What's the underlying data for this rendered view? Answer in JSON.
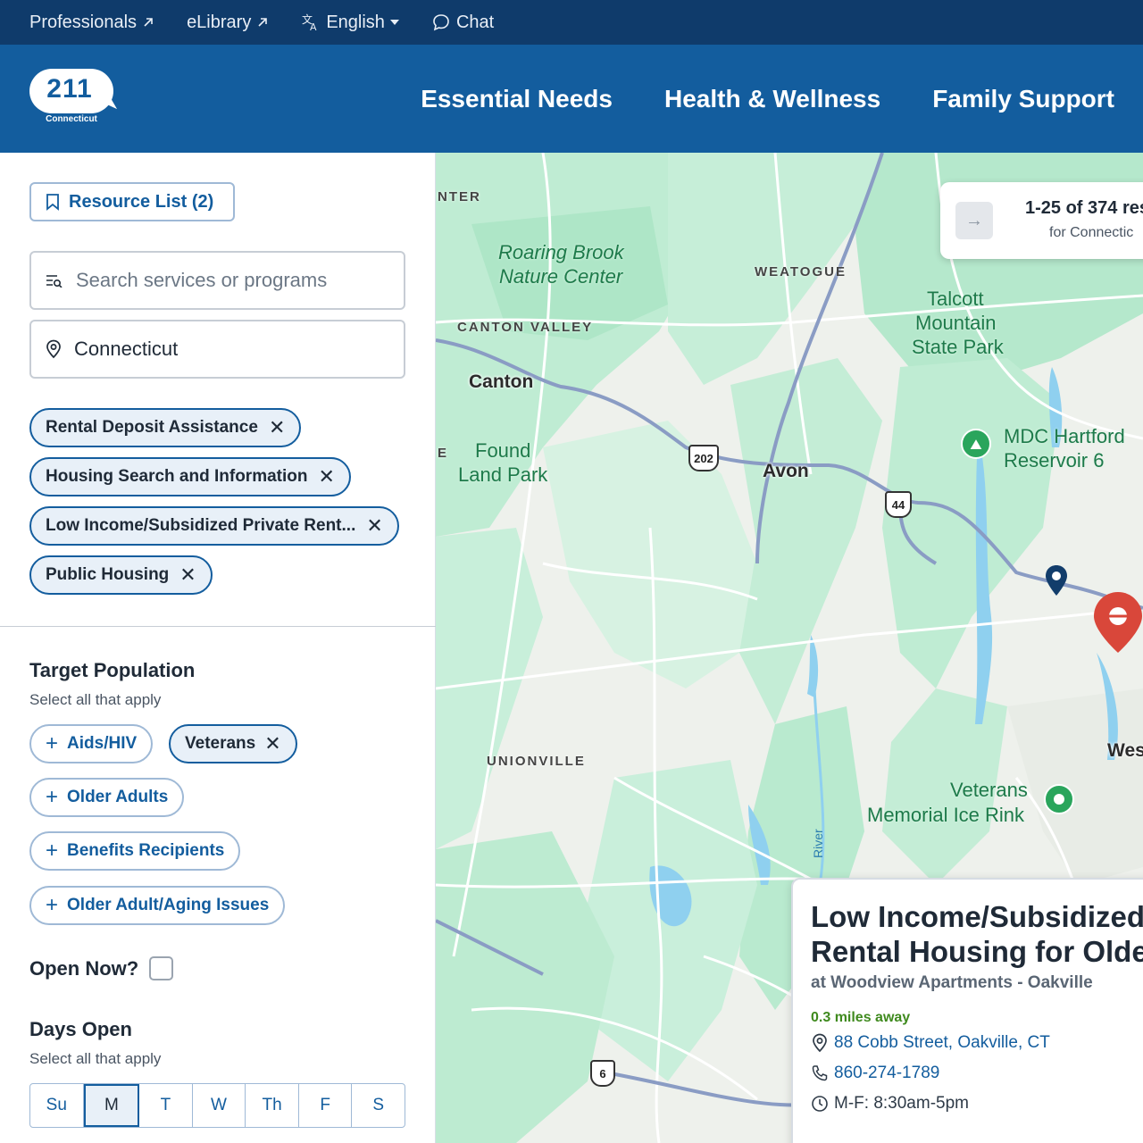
{
  "utilbar": {
    "professionals": "Professionals",
    "elibrary": "eLibrary",
    "language": "English",
    "chat": "Chat"
  },
  "header": {
    "logo_number": "211",
    "logo_subtitle": "Connecticut",
    "nav": [
      "Essential Needs",
      "Health & Wellness",
      "Family Support"
    ]
  },
  "sidebar": {
    "resource_list_label": "Resource List (2)",
    "search_placeholder": "Search services or programs",
    "location_value": "Connecticut",
    "selected_filters": [
      "Rental Deposit Assistance",
      "Housing Search and Information",
      "Low Income/Subsidized Private Rent...",
      "Public Housing"
    ],
    "target_population": {
      "title": "Target Population",
      "subtitle": "Select all that apply",
      "options": [
        {
          "label": "Aids/HIV",
          "selected": false
        },
        {
          "label": "Veterans",
          "selected": true
        },
        {
          "label": "Older Adults",
          "selected": false
        },
        {
          "label": "Benefits Recipients",
          "selected": false
        },
        {
          "label": "Older Adult/Aging Issues",
          "selected": false
        }
      ]
    },
    "open_now_label": "Open Now?",
    "days_open": {
      "title": "Days Open",
      "subtitle": "Select all that apply",
      "days": [
        "Su",
        "M",
        "T",
        "W",
        "Th",
        "F",
        "S"
      ],
      "selected": "M"
    }
  },
  "map": {
    "labels": {
      "nter": "NTER",
      "roaring": "Roaring Brook",
      "nature": "Nature Center",
      "weatogue": "WEATOGUE",
      "talcott1": "Talcott",
      "talcott2": "Mountain",
      "talcott3": "State Park",
      "canton_valley": "CANTON VALLEY",
      "canton": "Canton",
      "found1": "Found",
      "found2": "Land Park",
      "e": "E",
      "avon": "Avon",
      "mdc1": "MDC Hartford",
      "mdc2": "Reservoir 6",
      "unionville": "UNIONVILLE",
      "veterans1": "Veterans",
      "veterans2": "Memorial Ice Rink",
      "wes": "Wes",
      "river": "River"
    },
    "shields": {
      "r202": "202",
      "r44": "44",
      "r6": "6"
    },
    "results": {
      "count_text": "1-25 of 374 res",
      "location_text": "for Connectic"
    },
    "detail": {
      "title": "Low Income/Subsidized Rental Housing for Olde",
      "subtitle": "at Woodview Apartments - Oakville",
      "distance": "0.3 miles away",
      "address": "88 Cobb Street, Oakville, CT",
      "phone": "860-274-1789",
      "hours": "M-F: 8:30am-5pm"
    },
    "colors": {
      "park": "#b7ead0",
      "road": "#ffffff",
      "highway": "#8a9cc4",
      "water": "#7fc8e8",
      "pin_red": "#d9473a",
      "pin_navy": "#123d6b"
    }
  }
}
